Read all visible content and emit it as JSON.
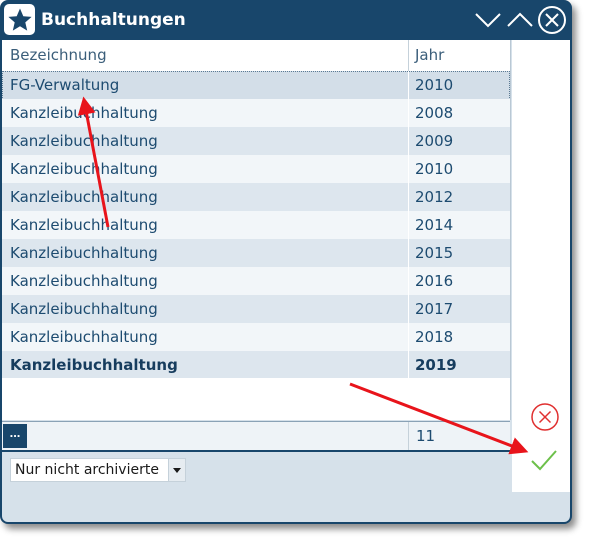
{
  "window": {
    "title": "Buchhaltungen"
  },
  "icons": {
    "app": "star-icon",
    "minimize": "chevron-down-icon",
    "maximize": "chevron-up-icon",
    "close": "close-circle-icon",
    "cancel": "cancel-circle-icon",
    "confirm": "checkmark-icon",
    "filter_dropdown": "dropdown-arrow-icon"
  },
  "colors": {
    "titlebar": "#18466b",
    "cancel": "#e03030",
    "confirm": "#6cc04a",
    "annotation_arrow": "#e8141b"
  },
  "grid": {
    "columns": [
      "Bezeichnung",
      "Jahr"
    ],
    "rows": [
      {
        "name": "FG-Verwaltung",
        "year": "2010"
      },
      {
        "name": "Kanzleibuchhaltung",
        "year": "2008"
      },
      {
        "name": "Kanzleibuchhaltung",
        "year": "2009"
      },
      {
        "name": "Kanzleibuchhaltung",
        "year": "2010"
      },
      {
        "name": "Kanzleibuchhaltung",
        "year": "2012"
      },
      {
        "name": "Kanzleibuchhaltung",
        "year": "2014"
      },
      {
        "name": "Kanzleibuchhaltung",
        "year": "2015"
      },
      {
        "name": "Kanzleibuchhaltung",
        "year": "2016"
      },
      {
        "name": "Kanzleibuchhaltung",
        "year": "2017"
      },
      {
        "name": "Kanzleibuchhaltung",
        "year": "2018"
      },
      {
        "name": "Kanzleibuchhaltung",
        "year": "2019"
      }
    ],
    "selected_row": "FG-Verwaltung",
    "bold_row": "Kanzleibuchhaltung 2019"
  },
  "summary": {
    "more_label": "...",
    "count": "11"
  },
  "filter": {
    "selected": "Nur nicht archivierte"
  }
}
